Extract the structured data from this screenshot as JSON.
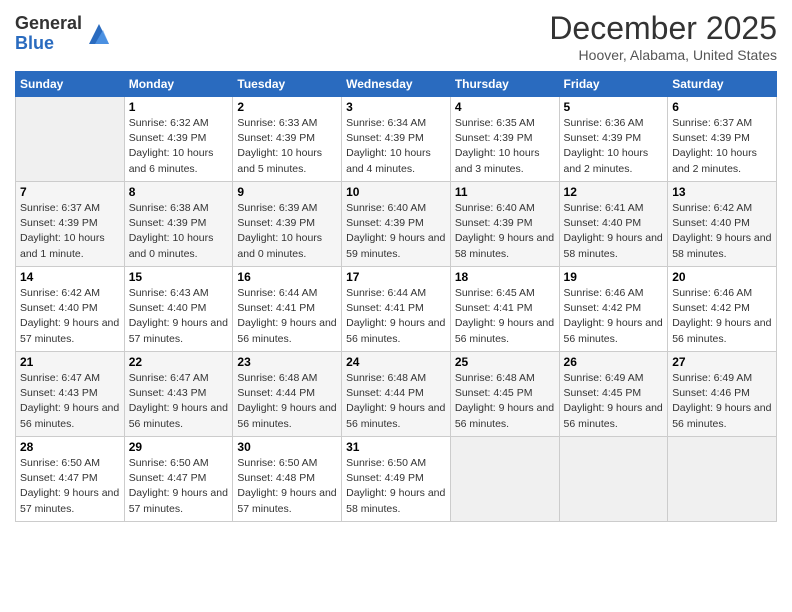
{
  "logo": {
    "general": "General",
    "blue": "Blue"
  },
  "title": "December 2025",
  "location": "Hoover, Alabama, United States",
  "days_of_week": [
    "Sunday",
    "Monday",
    "Tuesday",
    "Wednesday",
    "Thursday",
    "Friday",
    "Saturday"
  ],
  "weeks": [
    [
      {
        "day": "",
        "sunrise": "",
        "sunset": "",
        "daylight": "",
        "empty": true
      },
      {
        "day": "1",
        "sunrise": "Sunrise: 6:32 AM",
        "sunset": "Sunset: 4:39 PM",
        "daylight": "Daylight: 10 hours and 6 minutes."
      },
      {
        "day": "2",
        "sunrise": "Sunrise: 6:33 AM",
        "sunset": "Sunset: 4:39 PM",
        "daylight": "Daylight: 10 hours and 5 minutes."
      },
      {
        "day": "3",
        "sunrise": "Sunrise: 6:34 AM",
        "sunset": "Sunset: 4:39 PM",
        "daylight": "Daylight: 10 hours and 4 minutes."
      },
      {
        "day": "4",
        "sunrise": "Sunrise: 6:35 AM",
        "sunset": "Sunset: 4:39 PM",
        "daylight": "Daylight: 10 hours and 3 minutes."
      },
      {
        "day": "5",
        "sunrise": "Sunrise: 6:36 AM",
        "sunset": "Sunset: 4:39 PM",
        "daylight": "Daylight: 10 hours and 2 minutes."
      },
      {
        "day": "6",
        "sunrise": "Sunrise: 6:37 AM",
        "sunset": "Sunset: 4:39 PM",
        "daylight": "Daylight: 10 hours and 2 minutes."
      }
    ],
    [
      {
        "day": "7",
        "sunrise": "Sunrise: 6:37 AM",
        "sunset": "Sunset: 4:39 PM",
        "daylight": "Daylight: 10 hours and 1 minute."
      },
      {
        "day": "8",
        "sunrise": "Sunrise: 6:38 AM",
        "sunset": "Sunset: 4:39 PM",
        "daylight": "Daylight: 10 hours and 0 minutes."
      },
      {
        "day": "9",
        "sunrise": "Sunrise: 6:39 AM",
        "sunset": "Sunset: 4:39 PM",
        "daylight": "Daylight: 10 hours and 0 minutes."
      },
      {
        "day": "10",
        "sunrise": "Sunrise: 6:40 AM",
        "sunset": "Sunset: 4:39 PM",
        "daylight": "Daylight: 9 hours and 59 minutes."
      },
      {
        "day": "11",
        "sunrise": "Sunrise: 6:40 AM",
        "sunset": "Sunset: 4:39 PM",
        "daylight": "Daylight: 9 hours and 58 minutes."
      },
      {
        "day": "12",
        "sunrise": "Sunrise: 6:41 AM",
        "sunset": "Sunset: 4:40 PM",
        "daylight": "Daylight: 9 hours and 58 minutes."
      },
      {
        "day": "13",
        "sunrise": "Sunrise: 6:42 AM",
        "sunset": "Sunset: 4:40 PM",
        "daylight": "Daylight: 9 hours and 58 minutes."
      }
    ],
    [
      {
        "day": "14",
        "sunrise": "Sunrise: 6:42 AM",
        "sunset": "Sunset: 4:40 PM",
        "daylight": "Daylight: 9 hours and 57 minutes."
      },
      {
        "day": "15",
        "sunrise": "Sunrise: 6:43 AM",
        "sunset": "Sunset: 4:40 PM",
        "daylight": "Daylight: 9 hours and 57 minutes."
      },
      {
        "day": "16",
        "sunrise": "Sunrise: 6:44 AM",
        "sunset": "Sunset: 4:41 PM",
        "daylight": "Daylight: 9 hours and 56 minutes."
      },
      {
        "day": "17",
        "sunrise": "Sunrise: 6:44 AM",
        "sunset": "Sunset: 4:41 PM",
        "daylight": "Daylight: 9 hours and 56 minutes."
      },
      {
        "day": "18",
        "sunrise": "Sunrise: 6:45 AM",
        "sunset": "Sunset: 4:41 PM",
        "daylight": "Daylight: 9 hours and 56 minutes."
      },
      {
        "day": "19",
        "sunrise": "Sunrise: 6:46 AM",
        "sunset": "Sunset: 4:42 PM",
        "daylight": "Daylight: 9 hours and 56 minutes."
      },
      {
        "day": "20",
        "sunrise": "Sunrise: 6:46 AM",
        "sunset": "Sunset: 4:42 PM",
        "daylight": "Daylight: 9 hours and 56 minutes."
      }
    ],
    [
      {
        "day": "21",
        "sunrise": "Sunrise: 6:47 AM",
        "sunset": "Sunset: 4:43 PM",
        "daylight": "Daylight: 9 hours and 56 minutes."
      },
      {
        "day": "22",
        "sunrise": "Sunrise: 6:47 AM",
        "sunset": "Sunset: 4:43 PM",
        "daylight": "Daylight: 9 hours and 56 minutes."
      },
      {
        "day": "23",
        "sunrise": "Sunrise: 6:48 AM",
        "sunset": "Sunset: 4:44 PM",
        "daylight": "Daylight: 9 hours and 56 minutes."
      },
      {
        "day": "24",
        "sunrise": "Sunrise: 6:48 AM",
        "sunset": "Sunset: 4:44 PM",
        "daylight": "Daylight: 9 hours and 56 minutes."
      },
      {
        "day": "25",
        "sunrise": "Sunrise: 6:48 AM",
        "sunset": "Sunset: 4:45 PM",
        "daylight": "Daylight: 9 hours and 56 minutes."
      },
      {
        "day": "26",
        "sunrise": "Sunrise: 6:49 AM",
        "sunset": "Sunset: 4:45 PM",
        "daylight": "Daylight: 9 hours and 56 minutes."
      },
      {
        "day": "27",
        "sunrise": "Sunrise: 6:49 AM",
        "sunset": "Sunset: 4:46 PM",
        "daylight": "Daylight: 9 hours and 56 minutes."
      }
    ],
    [
      {
        "day": "28",
        "sunrise": "Sunrise: 6:50 AM",
        "sunset": "Sunset: 4:47 PM",
        "daylight": "Daylight: 9 hours and 57 minutes."
      },
      {
        "day": "29",
        "sunrise": "Sunrise: 6:50 AM",
        "sunset": "Sunset: 4:47 PM",
        "daylight": "Daylight: 9 hours and 57 minutes."
      },
      {
        "day": "30",
        "sunrise": "Sunrise: 6:50 AM",
        "sunset": "Sunset: 4:48 PM",
        "daylight": "Daylight: 9 hours and 57 minutes."
      },
      {
        "day": "31",
        "sunrise": "Sunrise: 6:50 AM",
        "sunset": "Sunset: 4:49 PM",
        "daylight": "Daylight: 9 hours and 58 minutes."
      },
      {
        "day": "",
        "sunrise": "",
        "sunset": "",
        "daylight": "",
        "empty": true
      },
      {
        "day": "",
        "sunrise": "",
        "sunset": "",
        "daylight": "",
        "empty": true
      },
      {
        "day": "",
        "sunrise": "",
        "sunset": "",
        "daylight": "",
        "empty": true
      }
    ]
  ]
}
